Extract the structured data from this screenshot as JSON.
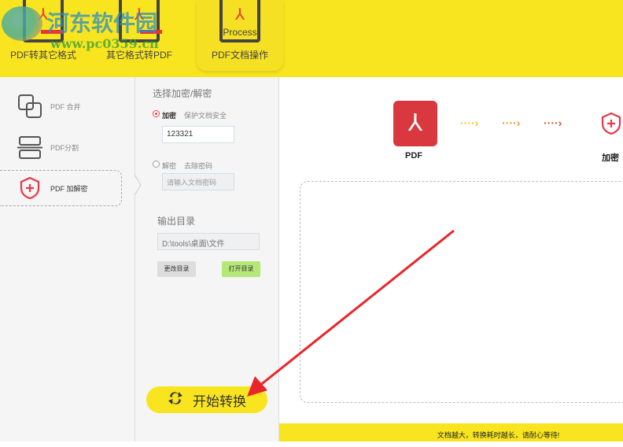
{
  "toolbar": {
    "items": [
      {
        "label": "PDF转其它格式"
      },
      {
        "label": "其它格式转PDF"
      },
      {
        "label": "PDF文档操作",
        "icon_text": "Process"
      }
    ]
  },
  "watermark": {
    "name": "河东软件园",
    "url": "www.pc0359.cn"
  },
  "sidebar": {
    "items": [
      {
        "label": "PDF 合并",
        "icon": "merge-icon"
      },
      {
        "label": "PDF分割",
        "icon": "split-icon"
      },
      {
        "label": "PDF 加解密",
        "icon": "shield-icon",
        "active": true
      }
    ]
  },
  "options": {
    "title": "选择加密/解密",
    "encrypt": {
      "label": "加密",
      "desc": "保护文档安全",
      "value": "123321",
      "selected": true
    },
    "decrypt": {
      "label": "解密",
      "desc": "去除密码",
      "placeholder": "请输入文档密码"
    },
    "output_title": "输出目录",
    "output_path": "D:\\tools\\桌面\\文件",
    "change_dir": "更改目录",
    "open_dir": "打开目录"
  },
  "start_button": "开始转换",
  "flow": {
    "from": "PDF",
    "to": "加密",
    "arrow_colors": [
      "#f5c518",
      "#f0902a",
      "#e04b3a"
    ]
  },
  "status": "文档越大，转换耗时越长，请耐心等待!",
  "colors": {
    "accent": "#f8e51f",
    "red": "#e33b3b"
  }
}
